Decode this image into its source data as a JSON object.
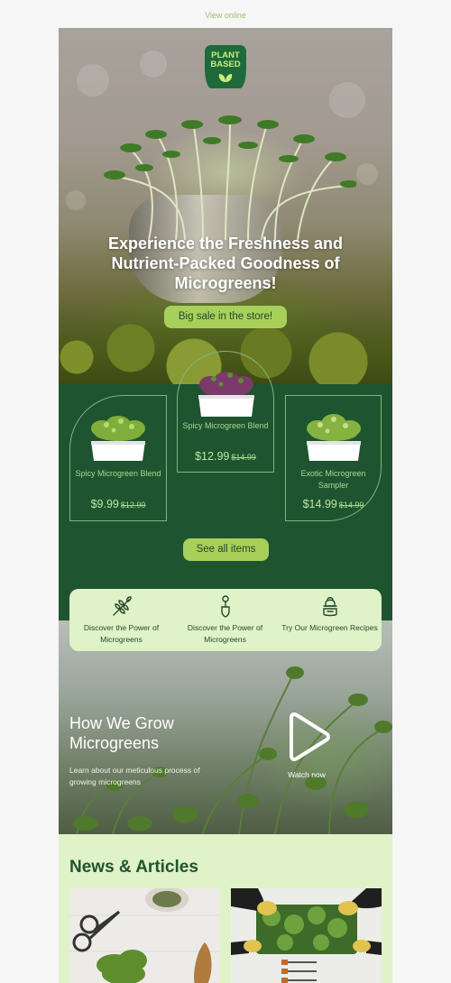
{
  "header": {
    "view_online": "View online"
  },
  "logo": {
    "line1": "PLANT",
    "line2": "BASED"
  },
  "hero": {
    "title": "Experience the Freshness and Nutrient-Packed Goodness of Microgreens!",
    "button": "Big sale in the store!"
  },
  "products": [
    {
      "name": "Spicy Microgreen Blend",
      "price": "$9.99",
      "old_price": "$12.99"
    },
    {
      "name": "Spicy Microgreen Blend",
      "price": "$12.99",
      "old_price": "$14.99"
    },
    {
      "name": "Exotic Microgreen Sampler",
      "price": "$14.99",
      "old_price": "$14.99"
    }
  ],
  "see_all": "See all items",
  "features": [
    {
      "label": "Discover the Power of Microgreens",
      "icon": "wheat-icon"
    },
    {
      "label": "Discover the Power of Microgreens",
      "icon": "trowel-icon"
    },
    {
      "label": "Try Our Microgreen Recipes",
      "icon": "chef-icon"
    }
  ],
  "video": {
    "title": "How We Grow Microgreens",
    "description": "Learn about our meticulous process of growing microgreens",
    "watch": "Watch now"
  },
  "news": {
    "title": "News & Articles"
  },
  "colors": {
    "brand_green": "#1e5430",
    "accent": "#a8cf5a",
    "pale": "#dff2c8"
  }
}
